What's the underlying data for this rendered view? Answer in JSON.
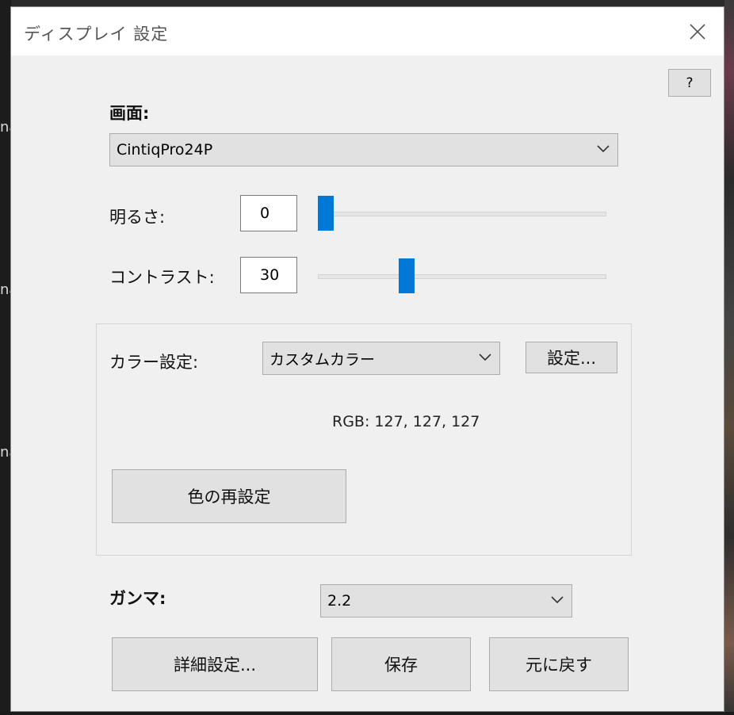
{
  "window": {
    "title": "ディスプレイ 設定",
    "help_label": "?"
  },
  "screen": {
    "label": "画面:",
    "selected": "CintiqPro24P"
  },
  "brightness": {
    "label": "明るさ:",
    "value": "0",
    "level_percent": 0
  },
  "contrast": {
    "label": "コントラスト:",
    "value": "30",
    "level_percent": 30
  },
  "color": {
    "label": "カラー設定:",
    "selected": "カスタムカラー",
    "settings_button": "設定...",
    "rgb_text": "RGB: 127, 127, 127",
    "reset_button": "色の再設定"
  },
  "gamma": {
    "label": "ガンマ:",
    "selected": "2.2"
  },
  "footer": {
    "advanced_button": "詳細設定...",
    "save_button": "保存",
    "revert_button": "元に戻す"
  },
  "colors": {
    "accent": "#0078d7",
    "dialog_bg": "#f0f0f0",
    "button_bg": "#e1e1e1"
  },
  "background": {
    "left_text_fragments": [
      "na",
      "na",
      "na"
    ]
  }
}
